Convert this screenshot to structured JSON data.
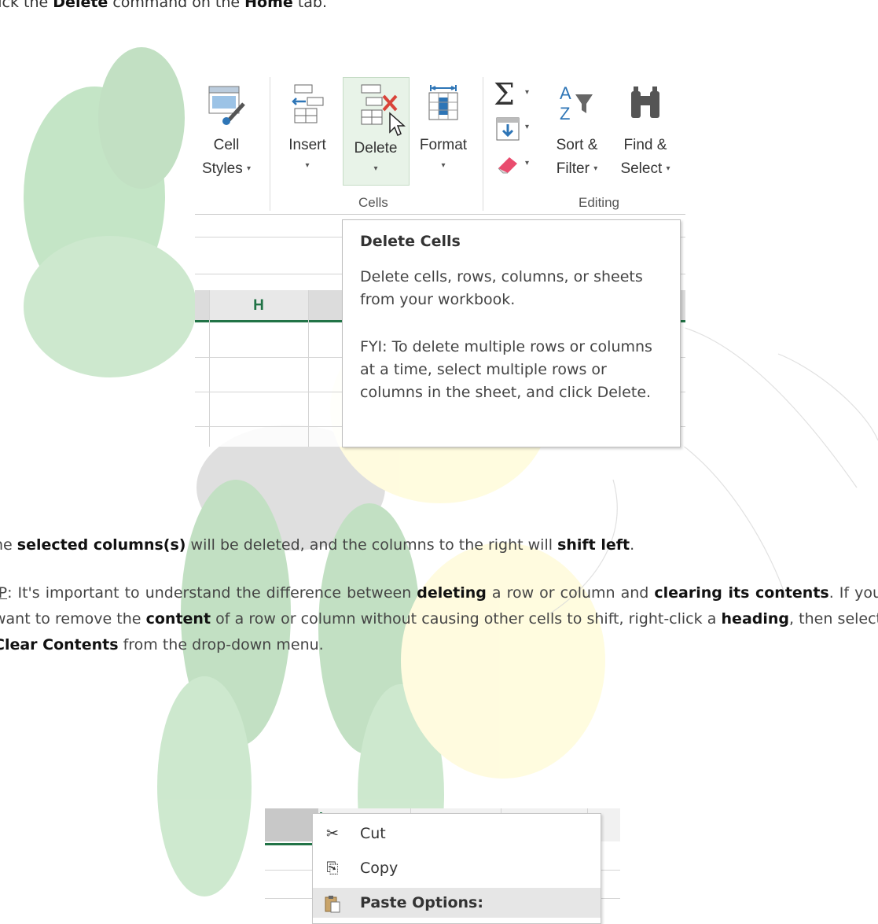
{
  "instruction": {
    "pre": "lick the ",
    "cmd": "Delete",
    "mid": " command on the ",
    "tab": "Home",
    "post": " tab."
  },
  "ribbon": {
    "cell_styles": [
      "Cell",
      "Styles"
    ],
    "insert": "Insert",
    "delete": "Delete",
    "format": "Format",
    "sort_filter": [
      "Sort &",
      "Filter"
    ],
    "find_select": [
      "Find &",
      "Select"
    ],
    "groups": {
      "cells": "Cells",
      "editing": "Editing"
    },
    "caret": "▾",
    "column_header": "H"
  },
  "tooltip": {
    "title": "Delete Cells",
    "body": "Delete cells, rows, columns, or sheets from your workbook.",
    "fyi": "FYI: To delete multiple rows or columns at a time, select multiple rows or columns in the sheet, and click Delete."
  },
  "para1": {
    "a": "he ",
    "b": "selected columns(s)",
    "c": " will be deleted, and the columns to the right will ",
    "d": "shift left",
    "e": "."
  },
  "para2": {
    "tip": "IP",
    "a": ": It's important to understand the difference between ",
    "b": "deleting",
    "c": " a row or column and ",
    "d": "clearing its contents",
    "e": ". If you want to remove the ",
    "f": "content",
    "g": " of a row or column without causing other cells to shift, right-click a ",
    "h": "heading",
    "i": ", then select ",
    "j": "Clear Contents",
    "k": " from the drop-down menu."
  },
  "context_menu": {
    "cut": "Cut",
    "copy": "Copy",
    "paste_options": "Paste Options:",
    "icons": [
      "scissors-icon",
      "copy-icon",
      "clipboard-icon"
    ]
  },
  "colors": {
    "excel_green": "#217346",
    "highlight": "#d6e9d6"
  }
}
